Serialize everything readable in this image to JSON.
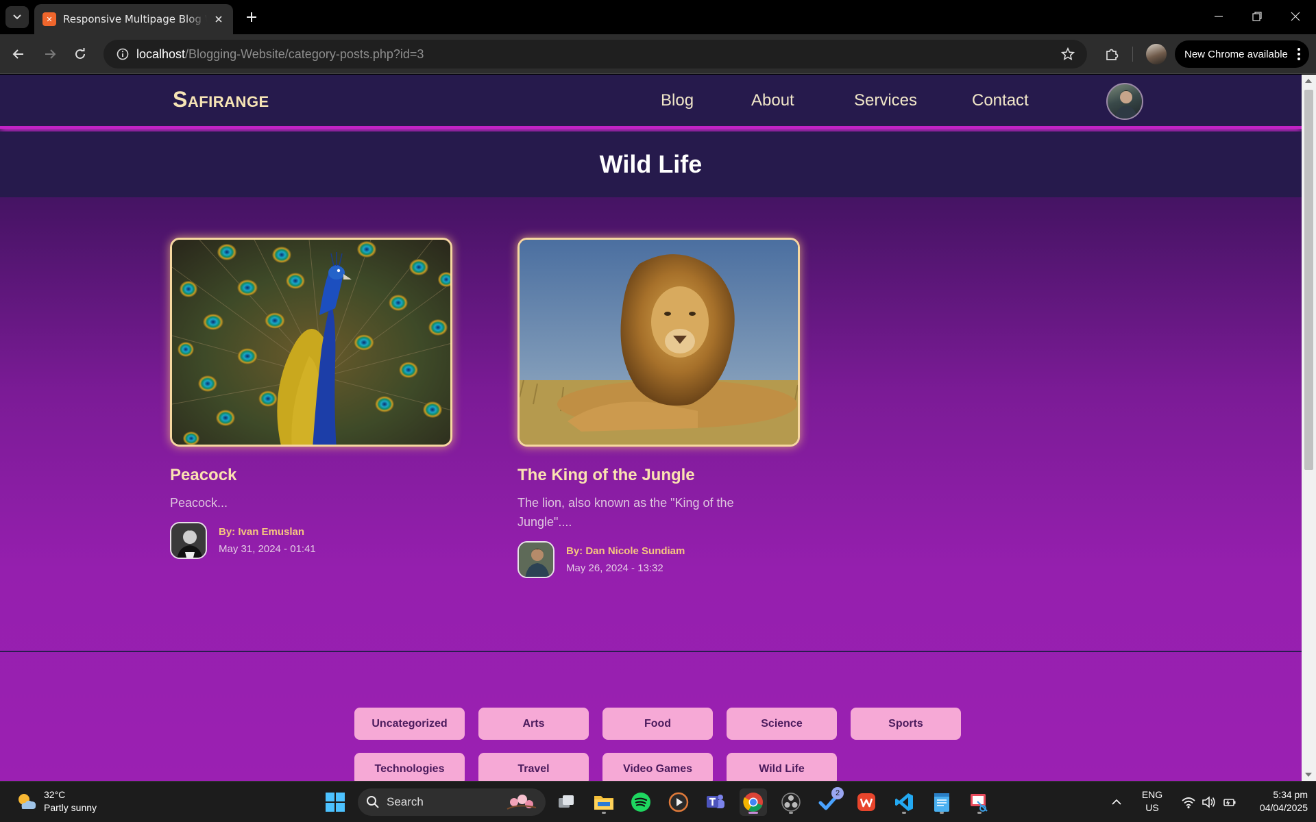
{
  "browser": {
    "tab_title": "Responsive Multipage Blog Website",
    "url_host": "localhost",
    "url_path": "/Blogging-Website/category-posts.php?id=3",
    "update_chip": "New Chrome available"
  },
  "site": {
    "logo": "Safirange",
    "nav": [
      "Blog",
      "About",
      "Services",
      "Contact"
    ],
    "page_title": "Wild Life"
  },
  "posts": [
    {
      "title": "Peacock",
      "excerpt": "Peacock...",
      "author": "By: Ivan Emuslan",
      "date": "May 31, 2024 - 01:41"
    },
    {
      "title": "The King of the Jungle",
      "excerpt": "The lion, also known as the \"King of the Jungle\"....",
      "author": "By: Dan Nicole Sundiam",
      "date": "May 26, 2024 - 13:32"
    }
  ],
  "categories": [
    "Uncategorized",
    "Arts",
    "Food",
    "Science",
    "Sports",
    "Technologies",
    "Travel",
    "Video Games",
    "Wild Life"
  ],
  "taskbar": {
    "weather_temp": "32°C",
    "weather_desc": "Partly sunny",
    "search_label": "Search",
    "todo_badge": "2",
    "lang_top": "ENG",
    "lang_bottom": "US",
    "time": "5:34 pm",
    "date": "04/04/2025"
  },
  "colors": {
    "nav_bg": "#261a4c",
    "accent_magenta": "#c223c5",
    "logo_cream": "#f6e4b5",
    "category_pink": "#f6a9d6",
    "author_gold": "#f6c67f"
  }
}
